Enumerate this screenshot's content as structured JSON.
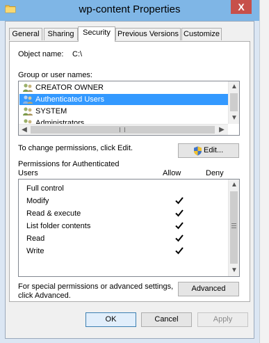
{
  "window": {
    "title": "wp-content Properties",
    "close_label": "X"
  },
  "tabs": [
    "General",
    "Sharing",
    "Security",
    "Previous Versions",
    "Customize"
  ],
  "active_tab": "Security",
  "object_name": {
    "label": "Object name:",
    "value": "C:\\"
  },
  "groups": {
    "label": "Group or user names:",
    "items": [
      {
        "name": "CREATOR OWNER",
        "selected": false
      },
      {
        "name": "Authenticated Users",
        "selected": true
      },
      {
        "name": "SYSTEM",
        "selected": false
      },
      {
        "name": "Administrators",
        "selected": false
      }
    ]
  },
  "change_permissions": {
    "text": "To change permissions, click Edit.",
    "edit_label": "Edit..."
  },
  "permissions": {
    "title_line1": "Permissions for Authenticated",
    "title_line2": "Users",
    "allow_label": "Allow",
    "deny_label": "Deny",
    "rows": [
      {
        "name": "Full control",
        "allow": false,
        "deny": false
      },
      {
        "name": "Modify",
        "allow": true,
        "deny": false
      },
      {
        "name": "Read & execute",
        "allow": true,
        "deny": false
      },
      {
        "name": "List folder contents",
        "allow": true,
        "deny": false
      },
      {
        "name": "Read",
        "allow": true,
        "deny": false
      },
      {
        "name": "Write",
        "allow": true,
        "deny": false
      }
    ]
  },
  "advanced": {
    "text_line1": "For special permissions or advanced settings,",
    "text_line2": "click Advanced.",
    "button_label": "Advanced"
  },
  "footer": {
    "ok_label": "OK",
    "cancel_label": "Cancel",
    "apply_label": "Apply"
  },
  "colors": {
    "selection": "#3399ff",
    "titlebar": "#7fb6e6",
    "close": "#c7504a"
  }
}
